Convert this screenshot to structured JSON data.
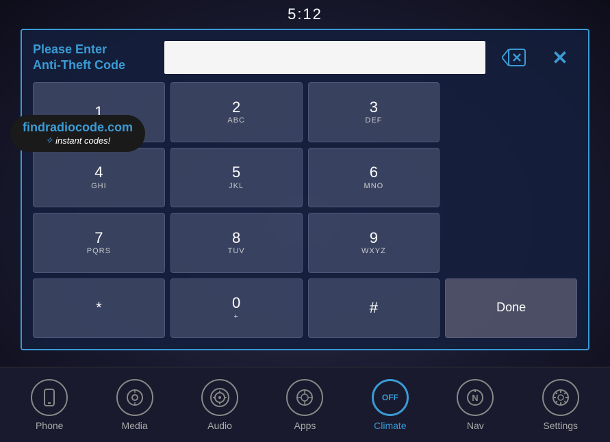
{
  "header": {
    "time": "5:12"
  },
  "dialog": {
    "prompt_line1": "Please Enter",
    "prompt_line2": "Anti-Theft Code",
    "input_value": "",
    "backspace_icon": "⌫",
    "close_icon": "✕"
  },
  "keypad": {
    "keys": [
      {
        "num": "1",
        "letters": "",
        "id": "key-1"
      },
      {
        "num": "2",
        "letters": "ABC",
        "id": "key-2"
      },
      {
        "num": "3",
        "letters": "DEF",
        "id": "key-3"
      },
      {
        "num": "4",
        "letters": "GHI",
        "id": "key-4"
      },
      {
        "num": "5",
        "letters": "JKL",
        "id": "key-5"
      },
      {
        "num": "6",
        "letters": "MNO",
        "id": "key-6"
      },
      {
        "num": "7",
        "letters": "PQRS",
        "id": "key-7"
      },
      {
        "num": "8",
        "letters": "TUV",
        "id": "key-8"
      },
      {
        "num": "9",
        "letters": "WXYZ",
        "id": "key-9"
      },
      {
        "num": "*",
        "letters": "",
        "id": "key-star"
      },
      {
        "num": "0",
        "letters": "+",
        "id": "key-0"
      },
      {
        "num": "#",
        "letters": "",
        "id": "key-hash"
      }
    ],
    "done_label": "Done"
  },
  "watermark": {
    "url": "findradiocode.com",
    "sub": "instant codes!"
  },
  "navbar": {
    "items": [
      {
        "label": "Phone",
        "icon": "📱",
        "id": "phone",
        "active": false
      },
      {
        "label": "Media",
        "icon": "♪",
        "id": "media",
        "active": false
      },
      {
        "label": "Audio",
        "icon": "🎚",
        "id": "audio",
        "active": false
      },
      {
        "label": "Apps",
        "icon": "⊙",
        "id": "apps",
        "active": false
      },
      {
        "label": "Climate",
        "icon": "OFF",
        "id": "climate",
        "active": true
      },
      {
        "label": "Nav",
        "icon": "N",
        "id": "nav",
        "active": false
      },
      {
        "label": "Settings",
        "icon": "⚙",
        "id": "settings",
        "active": false
      }
    ]
  }
}
